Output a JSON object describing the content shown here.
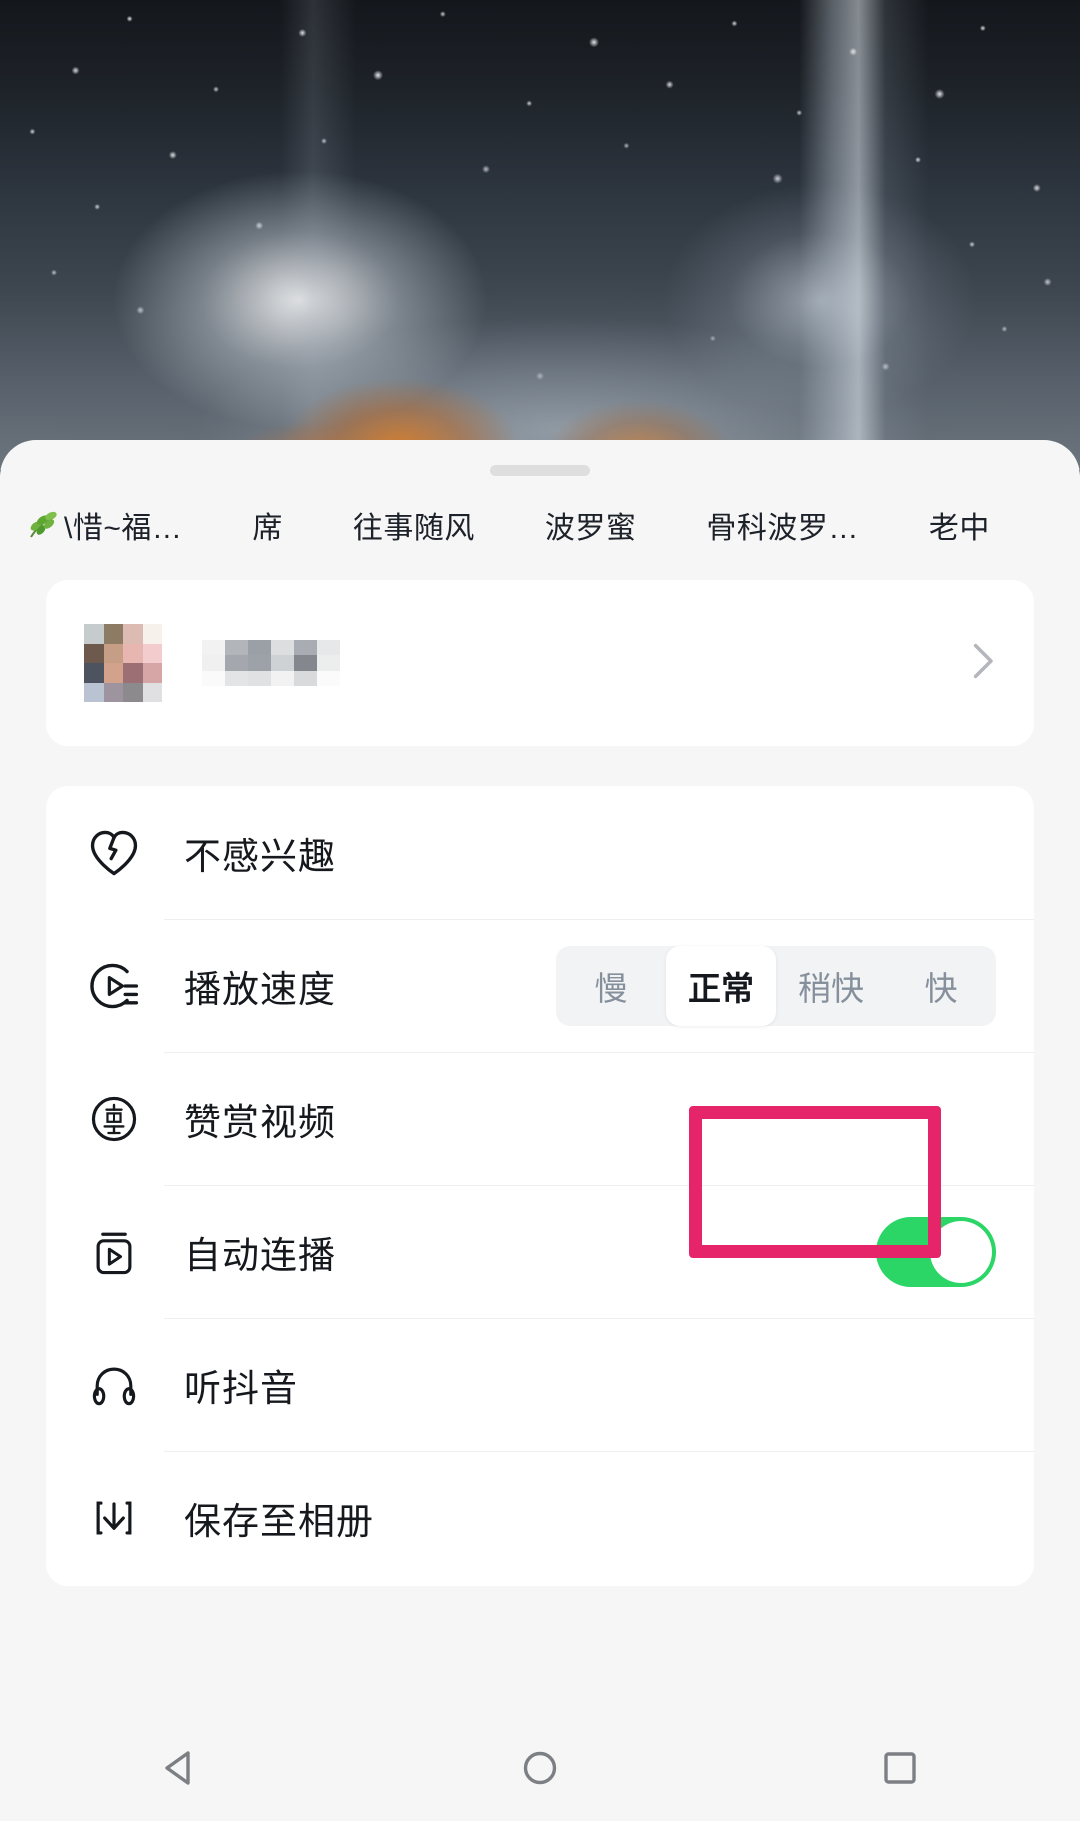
{
  "video": {
    "description": "dark rainy window with water droplets and warm orange glow at bottom"
  },
  "sheet": {
    "drag_handle": "drag-handle"
  },
  "tab_strip": {
    "tabs": [
      {
        "label": "\\惜~福…",
        "icon": "leaf-icon",
        "has_icon": true
      },
      {
        "label": "席",
        "has_icon": false
      },
      {
        "label": "往事随风",
        "has_icon": false
      },
      {
        "label": "波罗蜜",
        "has_icon": false
      },
      {
        "label": "骨科波罗…",
        "has_icon": false
      },
      {
        "label": "老中",
        "has_icon": false
      }
    ]
  },
  "user_card": {
    "avatar": "blurred-avatar",
    "name": "blurred-username",
    "chevron": "chevron-right-icon"
  },
  "options": [
    {
      "label": "不感兴趣",
      "icon": "broken-heart-icon",
      "control": "none"
    },
    {
      "label": "播放速度",
      "icon": "playback-speed-icon",
      "control": "segment"
    },
    {
      "label": "赞赏视频",
      "icon": "reward-icon",
      "control": "none"
    },
    {
      "label": "自动连播",
      "icon": "autoplay-icon",
      "control": "toggle"
    },
    {
      "label": "听抖音",
      "icon": "headphones-icon",
      "control": "none"
    },
    {
      "label": "保存至相册",
      "icon": "download-icon",
      "control": "none"
    }
  ],
  "speed_segment": {
    "options": [
      "慢",
      "正常",
      "稍快",
      "快"
    ],
    "selected": "正常",
    "selected_index": 1
  },
  "autoplay_toggle": {
    "state": "on",
    "on_color": "#2bd566",
    "knob_color": "#ffffff"
  },
  "annotation": {
    "target": "autoplay-toggle",
    "color": "#e6246a"
  },
  "nav_bar": {
    "buttons": [
      {
        "name": "back",
        "icon": "triangle-left-icon"
      },
      {
        "name": "home",
        "icon": "circle-icon"
      },
      {
        "name": "recents",
        "icon": "square-icon"
      }
    ]
  },
  "colors": {
    "panel_bg": "#f6f6f6",
    "card_bg": "#ffffff",
    "text_primary": "#15181d",
    "text_muted": "#86909c",
    "accent_green": "#2bd566",
    "accent_pink": "#e6246a"
  }
}
